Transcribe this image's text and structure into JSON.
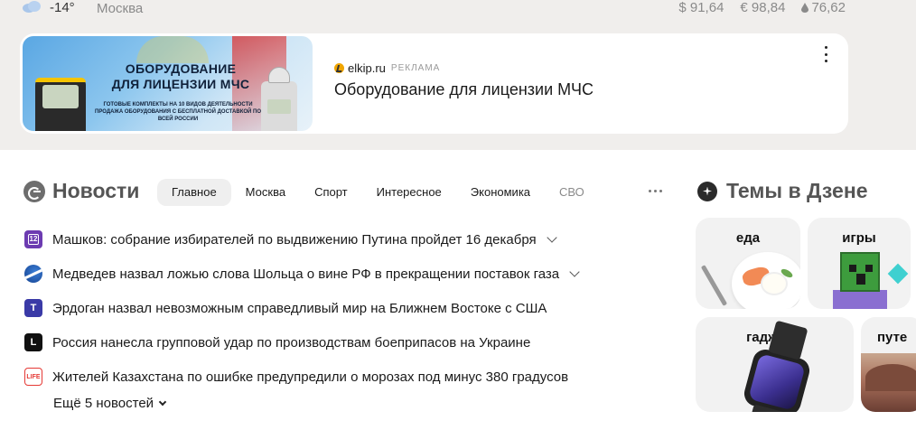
{
  "info": {
    "temperature": "-14°",
    "city": "Москва",
    "rates": [
      {
        "icon": "dollar",
        "value": "$ 91,64"
      },
      {
        "icon": "euro",
        "value": "€ 98,84"
      },
      {
        "icon": "oil-drop-icon",
        "value": "76,62"
      }
    ]
  },
  "ad": {
    "banner_title": "ОБОРУДОВАНИЕ\nДЛЯ ЛИЦЕНЗИИ МЧС",
    "banner_line1": "ГОТОВЫЕ КОМПЛЕКТЫ НА 10 ВИДОВ ДЕЯТЕЛЬНОСТИ",
    "banner_line2": "ПРОДАЖА ОБОРУДОВАНИЯ С БЕСПЛАТНОЙ ДОСТАВКОЙ ПО ВСЕЙ РОССИИ",
    "source": "elkip.ru",
    "tag": "РЕКЛАМА",
    "title": "Оборудование для лицензии МЧС"
  },
  "news": {
    "title": "Новости",
    "tabs": [
      {
        "label": "Главное",
        "active": true
      },
      {
        "label": "Москва"
      },
      {
        "label": "Спорт"
      },
      {
        "label": "Интересное"
      },
      {
        "label": "Экономика"
      },
      {
        "label": "СВО"
      }
    ],
    "items": [
      {
        "source_icon": "12-icon",
        "text": "Машков: собрание избирателей по выдвижению Путина пройдет 16 декабря",
        "expandable": true
      },
      {
        "source_icon": "globe-icon",
        "text": "Медведев назвал ложью слова Шольца о вине РФ в прекращении поставок газа",
        "expandable": true
      },
      {
        "source_icon": "t-icon",
        "text": "Эрдоган назвал невозможным справедливый мир на Ближнем Востоке с США",
        "expandable": false
      },
      {
        "source_icon": "l-icon",
        "text": "Россия нанесла групповой удар по производствам боеприпасов на Украине",
        "expandable": false
      },
      {
        "source_icon": "life-icon",
        "text": "Жителей Казахстана по ошибке предупредили о морозах под минус 380 градусов",
        "expandable": false
      }
    ],
    "more": "Ещё 5 новостей"
  },
  "dzen": {
    "title": "Темы в Дзене",
    "topics": [
      {
        "label": "еда"
      },
      {
        "label": "игры"
      },
      {
        "label": "гаджеты"
      },
      {
        "label": "путе"
      }
    ]
  }
}
